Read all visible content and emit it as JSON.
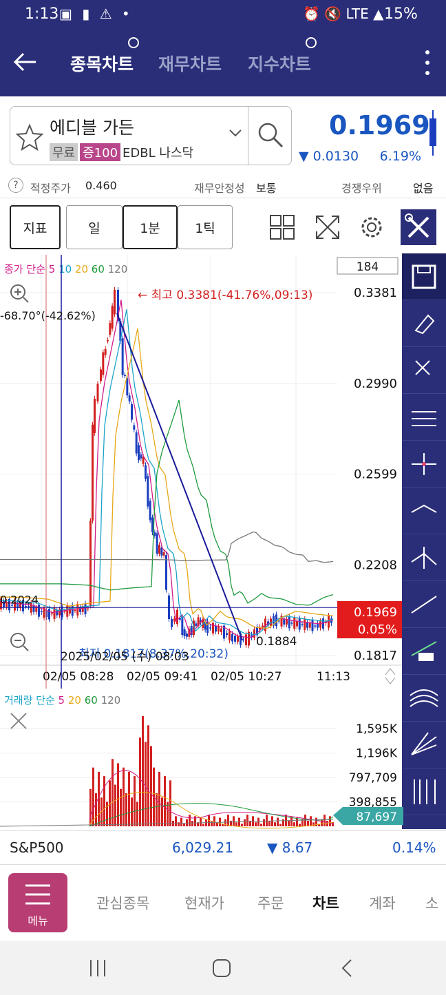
{
  "status": {
    "time": "1:13",
    "right": "LTE",
    "battery": "15%"
  },
  "header": {
    "tabs": [
      {
        "label": "종목차트"
      },
      {
        "label": "재무차트"
      },
      {
        "label": "지수차트"
      }
    ]
  },
  "stock": {
    "name": "에디블 가든",
    "tags": [
      "무료",
      "증100"
    ],
    "ticker": "EDBL",
    "exchange": "나스닥",
    "price": "0.1969",
    "change": "0.0130",
    "change_pct": "6.19%"
  },
  "info": {
    "fair_label": "적정주가",
    "fair_value": "0.460",
    "fin_label": "재무안정성",
    "fin_value": "보통",
    "comp_label": "경쟁우위",
    "comp_value": "없음"
  },
  "toolbar": {
    "indicator": "지표",
    "day": "일",
    "min1": "1분",
    "tick1": "1틱"
  },
  "chart": {
    "legend_prefix": "종가 단순",
    "ma": [
      "5",
      "10",
      "20",
      "60",
      "120"
    ],
    "count_box": "184",
    "high_label": "최고 0.3381(-41.76%,09:13)",
    "low_label": "최저 0.1817(8.37%,20:32)",
    "trend_label": "-68.70°(-42.62%)",
    "crosshair_price": "0.2024",
    "crosshair_date": "2025/02/05 (수) 08:03",
    "last_price_tag": "0.1969",
    "last_pct_tag": "0.05%",
    "point_label": "0.1884",
    "y_ticks": [
      "0.3381",
      "0.2990",
      "0.2599",
      "0.2208",
      "0.1817"
    ],
    "x_ticks": [
      "02/05 08:28",
      "02/05 09:41",
      "02/05 10:27",
      "11:13"
    ]
  },
  "volume": {
    "legend_prefix": "거래량 단순",
    "ma": [
      "5",
      "20",
      "60",
      "120"
    ],
    "y_ticks": [
      "1,595K",
      "1,196K",
      "797,709",
      "398,855"
    ],
    "last_tag": "87,697"
  },
  "colors": {
    "ma5": "#d11d8a",
    "ma10": "#1aa3c9",
    "ma20": "#e6a817",
    "ma60": "#1e9a3c",
    "ma120": "#777777",
    "up": "#d32020",
    "down": "#1b3fbf",
    "navy": "#2a2e78"
  },
  "ticker": {
    "name": "S&P500",
    "value": "6,029.21",
    "change": "8.67",
    "pct": "0.14%"
  },
  "bottom_nav": {
    "menu": "메뉴",
    "items": [
      "관심종목",
      "현재가",
      "주문",
      "차트",
      "계좌",
      "소"
    ]
  },
  "chart_data": {
    "type": "candlestick",
    "title": "",
    "y_ticks": [
      "0.3381",
      "0.2990",
      "0.2599",
      "0.2208",
      "0.1817"
    ],
    "x_ticks": [
      "02/05 08:28",
      "02/05 09:41",
      "02/05 10:27",
      "11:13"
    ],
    "high": 0.3381,
    "low": 0.1817,
    "last": 0.1969
  }
}
